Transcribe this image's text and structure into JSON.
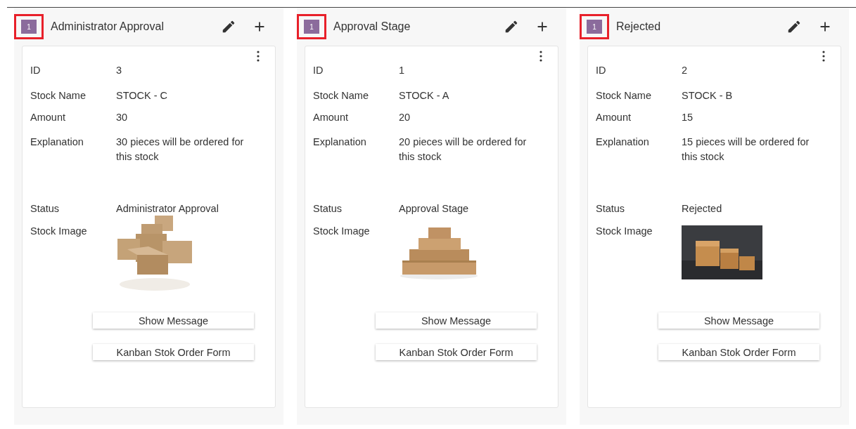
{
  "columns": [
    {
      "title": "Administrator Approval",
      "count": "1",
      "highlighted": true,
      "card": {
        "fields": [
          {
            "label": "ID",
            "value": "3"
          },
          {
            "label": "Stock Name",
            "value": "STOCK - C"
          },
          {
            "label": "Amount",
            "value": "30"
          },
          {
            "label": "Explanation",
            "value": "30 pieces will be ordered for this stock"
          },
          {
            "label": "Status",
            "value": "Administrator Approval"
          }
        ],
        "image_label": "Stock Image",
        "buttons": [
          "Show Message",
          "Kanban Stok Order Form"
        ]
      }
    },
    {
      "title": "Approval Stage",
      "count": "1",
      "highlighted": true,
      "card": {
        "fields": [
          {
            "label": "ID",
            "value": "1"
          },
          {
            "label": "Stock Name",
            "value": "STOCK - A"
          },
          {
            "label": "Amount",
            "value": "20"
          },
          {
            "label": "Explanation",
            "value": "20 pieces will be ordered for this stock"
          },
          {
            "label": "Status",
            "value": "Approval Stage"
          }
        ],
        "image_label": "Stock Image",
        "buttons": [
          "Show Message",
          "Kanban Stok Order Form"
        ]
      }
    },
    {
      "title": "Rejected",
      "count": "1",
      "highlighted": true,
      "card": {
        "fields": [
          {
            "label": "ID",
            "value": "2"
          },
          {
            "label": "Stock Name",
            "value": "STOCK - B"
          },
          {
            "label": "Amount",
            "value": "15"
          },
          {
            "label": "Explanation",
            "value": "15 pieces will be ordered for this stock"
          },
          {
            "label": "Status",
            "value": "Rejected"
          }
        ],
        "image_label": "Stock Image",
        "buttons": [
          "Show Message",
          "Kanban Stok Order Form"
        ]
      }
    }
  ]
}
